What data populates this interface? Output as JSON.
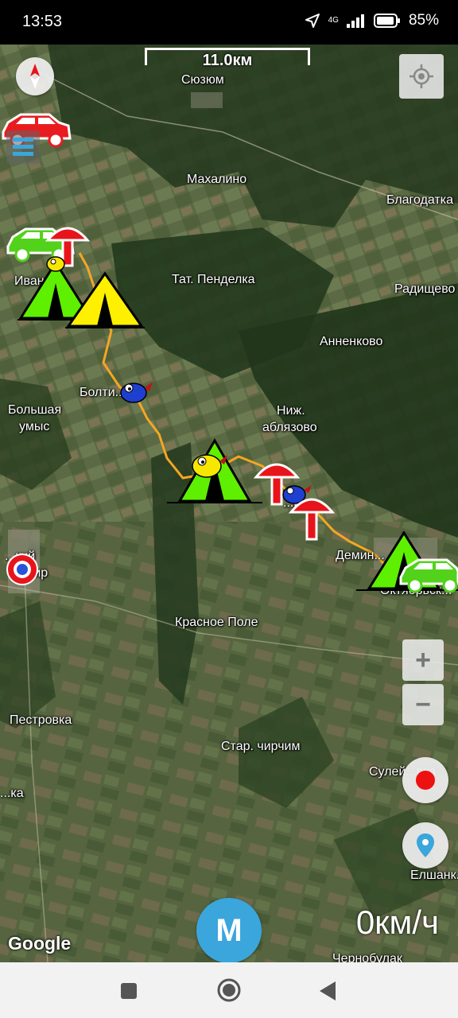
{
  "status_bar": {
    "time": "13:53",
    "network": "4G",
    "battery": "85%",
    "icons": [
      "navigation-arrow-icon",
      "signal-icon",
      "battery-icon"
    ]
  },
  "map": {
    "scale_label": "11.0км",
    "attribution": "Google",
    "speed": "0км/ч",
    "places": [
      {
        "name": "Сюзюм"
      },
      {
        "name": "Махалино"
      },
      {
        "name": "Благодатка"
      },
      {
        "name": "Иван..."
      },
      {
        "name": "Тат. Пенделка"
      },
      {
        "name": "Радищево"
      },
      {
        "name": "Анненково"
      },
      {
        "name": "Болти..."
      },
      {
        "name": "Большая"
      },
      {
        "name": "умыс"
      },
      {
        "name": "Ниж."
      },
      {
        "name": "аблязово"
      },
      {
        "name": "...им"
      },
      {
        "name": "Демин..."
      },
      {
        "name": "...кий"
      },
      {
        "name": "...кир"
      },
      {
        "name": "Октябрьск..."
      },
      {
        "name": "Красное Поле"
      },
      {
        "name": "Пестровка"
      },
      {
        "name": "Стар. чирчим"
      },
      {
        "name": "Сулей...вка"
      },
      {
        "name": "...ка"
      },
      {
        "name": "Елшанк..."
      },
      {
        "name": "Чернобулак"
      }
    ],
    "colors": {
      "route": "#f5a623",
      "tent_green": "#5ef000",
      "tent_yellow": "#fff000",
      "mushroom": "#e8141b",
      "car_green": "#52d21a",
      "car_red": "#e81c20",
      "record": "#ee1111",
      "brand_m": "#3aa6dc"
    }
  },
  "controls": {
    "compass": "compass-icon",
    "menu": "menu-icon",
    "locate": "locate-icon",
    "zoom_in": "+",
    "zoom_out": "−",
    "record": "record-icon",
    "waypoint": "map-pin-icon",
    "m_button": "M"
  },
  "nav_bar": [
    "recent-apps-icon",
    "home-icon",
    "back-icon"
  ]
}
